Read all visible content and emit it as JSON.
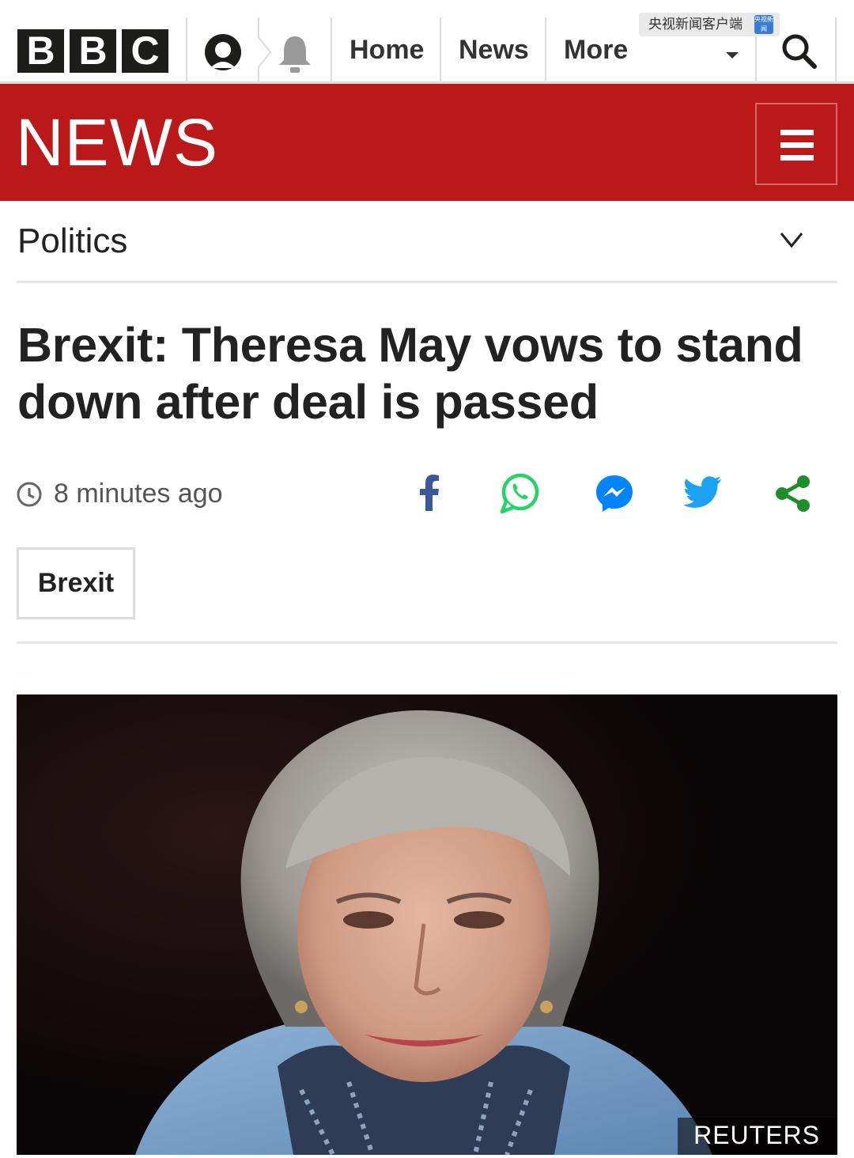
{
  "top_nav": {
    "logo_letters": [
      "B",
      "B",
      "C"
    ],
    "home_label": "Home",
    "news_label": "News",
    "more_label": "More",
    "account_icon": "account-icon",
    "notifications_icon": "bell-icon",
    "search_icon": "search-icon"
  },
  "watermark": {
    "text": "央视新闻客户端",
    "logo_text": "央视新闻"
  },
  "news_band": {
    "wordmark": "NEWS",
    "menu_icon": "hamburger-menu-icon",
    "color": "#bb1919"
  },
  "section": {
    "title": "Politics",
    "toggle_icon": "chevron-down-icon"
  },
  "article": {
    "headline": "Brexit: Theresa May vows to stand down after deal is passed",
    "timestamp": "8 minutes ago",
    "tag": "Brexit",
    "image_credit": "REUTERS"
  },
  "share": [
    {
      "name": "facebook",
      "color": "#3b5998"
    },
    {
      "name": "whatsapp",
      "color": "#25d366"
    },
    {
      "name": "messenger",
      "color": "#0084ff"
    },
    {
      "name": "twitter",
      "color": "#1da1f2"
    },
    {
      "name": "share",
      "color": "#1e8e2b"
    }
  ]
}
